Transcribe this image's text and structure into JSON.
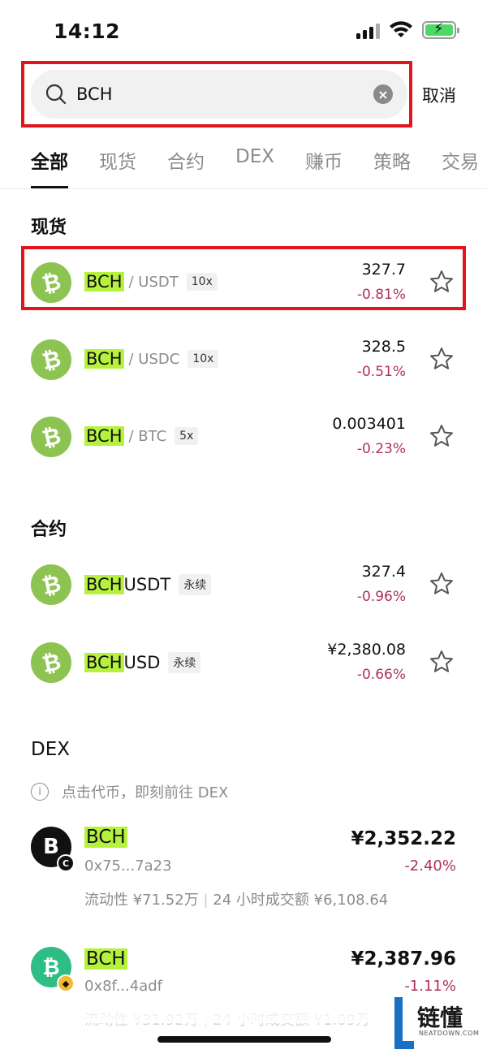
{
  "status": {
    "time": "14:12"
  },
  "search": {
    "query": "BCH",
    "cancel_label": "取消"
  },
  "tabs": [
    {
      "label": "全部",
      "active": true
    },
    {
      "label": "现货",
      "active": false
    },
    {
      "label": "合约",
      "active": false
    },
    {
      "label": "DEX",
      "active": false
    },
    {
      "label": "赚币",
      "active": false
    },
    {
      "label": "策略",
      "active": false
    },
    {
      "label": "交易",
      "active": false
    }
  ],
  "spot": {
    "title": "现货",
    "rows": [
      {
        "base": "BCH",
        "quote": "/ USDT",
        "leverage": "10x",
        "price": "327.7",
        "change": "-0.81%"
      },
      {
        "base": "BCH",
        "quote": "/ USDC",
        "leverage": "10x",
        "price": "328.5",
        "change": "-0.51%"
      },
      {
        "base": "BCH",
        "quote": "/ BTC",
        "leverage": "5x",
        "price": "0.003401",
        "change": "-0.23%"
      }
    ]
  },
  "futures": {
    "title": "合约",
    "rows": [
      {
        "base": "BCH",
        "suffix": "USDT",
        "tag": "永续",
        "price": "327.4",
        "change": "-0.96%"
      },
      {
        "base": "BCH",
        "suffix": "USD",
        "tag": "永续",
        "price": "¥2,380.08",
        "change": "-0.66%"
      }
    ]
  },
  "dex": {
    "title": "DEX",
    "note": "点击代币，即刻前往 DEX",
    "rows": [
      {
        "name": "BCH",
        "address": "0x75...7a23",
        "liquidity": "流动性 ¥71.52万",
        "volume": "24 小时成交额 ¥6,108.64",
        "price": "¥2,352.22",
        "change": "-2.40%",
        "icon_letter": "B",
        "icon_color": "#111111"
      },
      {
        "name": "BCH",
        "address": "0x8f...4adf",
        "liquidity": "流动性 ¥31.92万",
        "volume": "24 小时成交额 ¥1.09万",
        "price": "¥2,387.96",
        "change": "-1.11%",
        "icon_letter": "₿",
        "icon_color": "#2ebd85"
      }
    ]
  },
  "watermark": {
    "text": "链懂",
    "sub": "NEATDOWN.COM"
  },
  "colors": {
    "highlight": "#b5f23d",
    "negative": "#b03060",
    "annotation": "#e3141b",
    "bch_green": "#8dc351"
  }
}
